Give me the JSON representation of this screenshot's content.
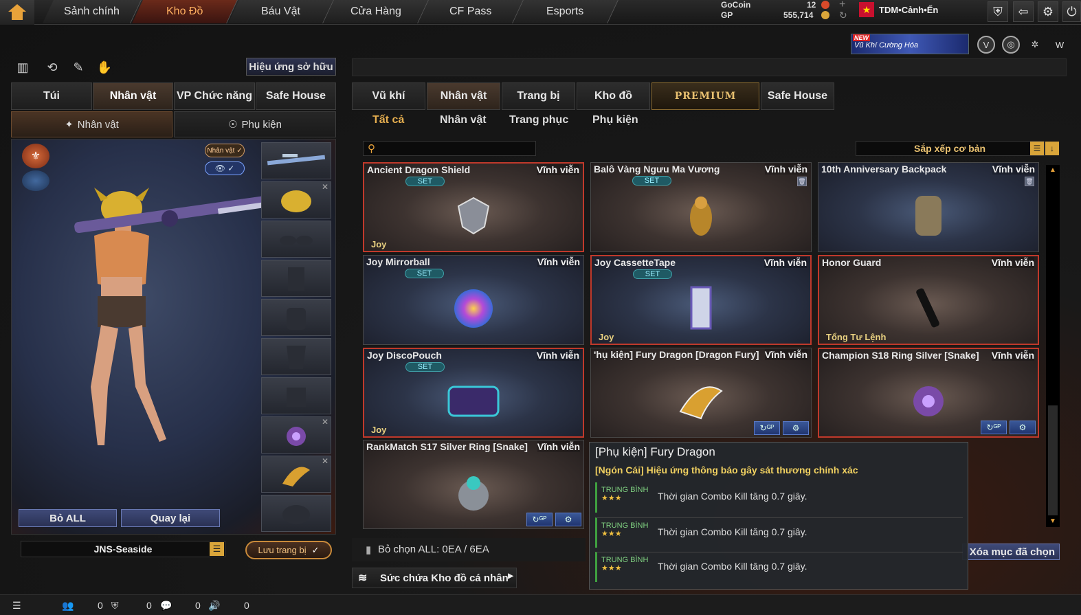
{
  "nav": {
    "tabs": [
      "Sảnh chính",
      "Kho Đồ",
      "Báu Vật",
      "Cửa Hàng",
      "CF Pass",
      "Esports"
    ],
    "active": "Kho Đồ"
  },
  "currency": {
    "gocoin_label": "GoCoin",
    "gocoin_value": "12",
    "gp_label": "GP",
    "gp_value": "555,714"
  },
  "user": {
    "name": "TDM•Cảnh•Ến",
    "flag": "★"
  },
  "promo": {
    "badge": "NEW",
    "text": "Vũ Khí Cường Hóa"
  },
  "left": {
    "effect_button": "Hiệu ứng sở hữu",
    "tabs": [
      "Túi",
      "Nhân vật",
      "VP Chức năng",
      "Safe House"
    ],
    "subtabs": [
      "Nhân vật",
      "Phụ kiện"
    ],
    "char_badge": "Nhân vật ✓",
    "eye_badge": "👁 ✓",
    "btn_remove_all": "Bỏ ALL",
    "btn_back": "Quay lại",
    "preset_name": "JNS-Seaside",
    "save_button": "Lưu trang bị"
  },
  "right": {
    "tabs": [
      "Vũ khí",
      "Nhân vật",
      "Trang bị",
      "Kho đồ",
      "PREMIUM",
      "Safe House"
    ],
    "subtabs": [
      "Tất cả",
      "Nhân vật",
      "Trang phục",
      "Phụ kiện"
    ],
    "search_placeholder": "",
    "sort_label": "Sắp xếp cơ bản",
    "items": [
      {
        "name": "Ancient Dragon Shield",
        "duration": "Vĩnh viễn",
        "set": "SET",
        "footer": "Joy",
        "selected": true,
        "theme": "brown"
      },
      {
        "name": "Balô Vàng Ngưu Ma Vương",
        "duration": "Vĩnh viễn",
        "set": "SET",
        "footer": "",
        "selected": false,
        "theme": "brown"
      },
      {
        "name": "10th Anniversary Backpack",
        "duration": "Vĩnh viễn",
        "set": "",
        "footer": "",
        "selected": false,
        "theme": "blue"
      },
      {
        "name": "Joy Mirrorball",
        "duration": "Vĩnh viễn",
        "set": "SET",
        "footer": "",
        "selected": false,
        "theme": "blue"
      },
      {
        "name": "Joy CassetteTape",
        "duration": "Vĩnh viễn",
        "set": "SET",
        "footer": "Joy",
        "selected": true,
        "theme": "blue"
      },
      {
        "name": "Honor Guard",
        "duration": "Vĩnh viễn",
        "set": "",
        "footer": "Tổng Tư Lệnh",
        "selected": true,
        "theme": "brown"
      },
      {
        "name": "Joy DiscoPouch",
        "duration": "Vĩnh viễn",
        "set": "SET",
        "footer": "Joy",
        "selected": true,
        "theme": "blue"
      },
      {
        "name": "'hụ kiện] Fury Dragon [Dragon Fury]",
        "duration": "Vĩnh viễn",
        "set": "",
        "footer": "",
        "selected": false,
        "theme": "brown"
      },
      {
        "name": "Champion S18 Ring Silver [Snake]",
        "duration": "Vĩnh viễn",
        "set": "",
        "footer": "",
        "selected": true,
        "theme": "brown"
      },
      {
        "name": "RankMatch S17 Silver Ring [Snake]",
        "duration": "Vĩnh viễn",
        "set": "",
        "footer": "",
        "selected": false,
        "theme": "brown"
      }
    ],
    "bottom_info": "Bỏ chọn ALL: 0EA / 6EA",
    "capacity": "Sức chứa Kho đồ cá nhân",
    "delete_selected": "Xóa mục đã chọn"
  },
  "tooltip": {
    "title": "[Phụ kiện] Fury Dragon",
    "subtitle": "[Ngón Cái] Hiệu ứng thông báo gây sát thương chính xác",
    "rows": [
      {
        "tier": "TRUNG BÌNH",
        "stars": "★★★",
        "text": "Thời gian Combo Kill tăng 0.7 giây."
      },
      {
        "tier": "TRUNG BÌNH",
        "stars": "★★★",
        "text": "Thời gian Combo Kill tăng 0.7 giây."
      },
      {
        "tier": "TRUNG BÌNH",
        "stars": "★★★",
        "text": "Thời gian Combo Kill tăng 0.7 giây."
      }
    ]
  },
  "status": {
    "count1": "0",
    "count2": "0",
    "count3": "0",
    "count4": "0"
  }
}
